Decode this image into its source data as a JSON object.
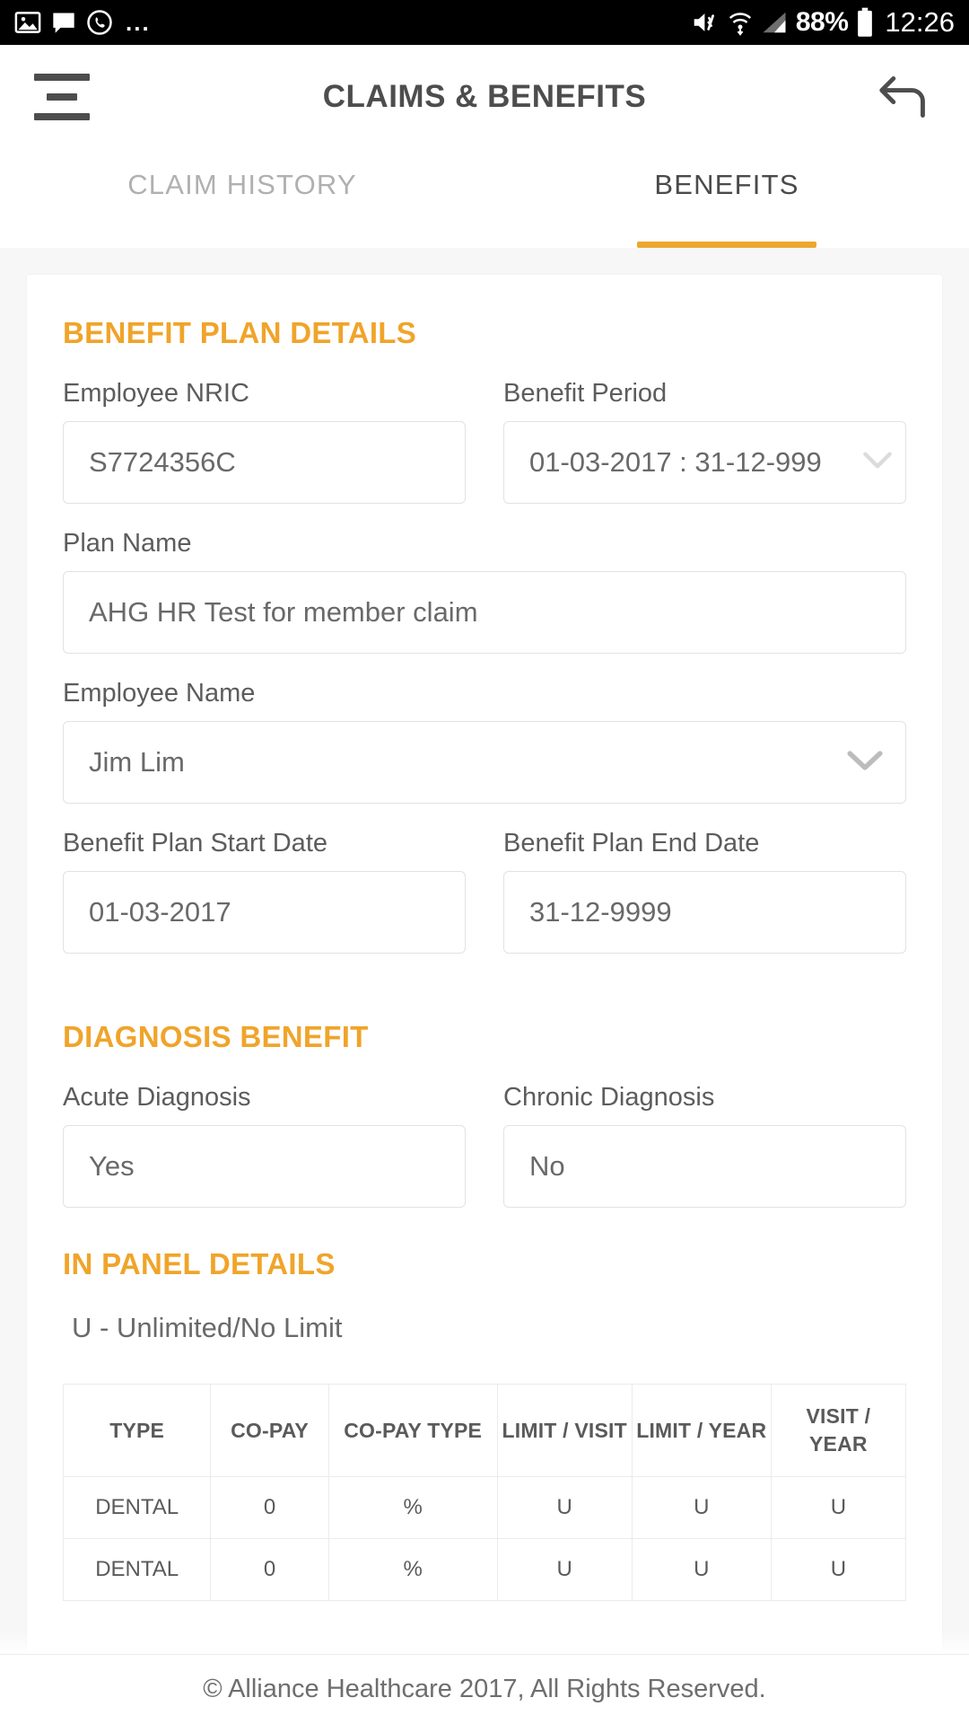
{
  "status_bar": {
    "left_icons": [
      "image-icon",
      "message-icon",
      "whatsapp-icon",
      "more-dots-icon"
    ],
    "overflow_dots": "...",
    "right_icons": [
      "mute-icon",
      "wifi-icon",
      "signal-icon",
      "battery-icon"
    ],
    "battery_percent": "88%",
    "clock": "12:26"
  },
  "header": {
    "menu_icon": "hamburger-menu-icon",
    "title": "CLAIMS & BENEFITS",
    "back_icon": "back-arrow-icon"
  },
  "tabs": [
    {
      "label": "CLAIM HISTORY",
      "active": false
    },
    {
      "label": "BENEFITS",
      "active": true
    }
  ],
  "colors": {
    "accent": "#eda72f",
    "section_title": "#f0a42a",
    "text": "#5c5c5c",
    "value_text": "#696969",
    "inactive_tab": "#b0b0b0",
    "page_bg": "#f7f7f7"
  },
  "benefit_plan_details": {
    "title": "BENEFIT PLAN DETAILS",
    "fields": [
      {
        "label": "Employee NRIC",
        "value": "S7724356C",
        "dropdown": false
      },
      {
        "label": "Benefit Period",
        "value": "01-03-2017 : 31-12-999",
        "dropdown": true
      },
      {
        "label": "Plan Name",
        "value": "AHG HR Test for member claim",
        "dropdown": false
      },
      {
        "label": "Employee Name",
        "value": "Jim Lim",
        "dropdown": true
      },
      {
        "label": "Benefit Plan Start Date",
        "value": "01-03-2017",
        "dropdown": false
      },
      {
        "label": "Benefit Plan End Date",
        "value": "31-12-9999",
        "dropdown": false
      }
    ]
  },
  "diagnosis_benefit": {
    "title": "DIAGNOSIS BENEFIT",
    "fields": [
      {
        "label": "Acute Diagnosis",
        "value": "Yes"
      },
      {
        "label": "Chronic Diagnosis",
        "value": "No"
      }
    ]
  },
  "in_panel_details": {
    "title": "IN PANEL DETAILS",
    "legend": "U - Unlimited/No Limit",
    "table": {
      "headers": [
        "TYPE",
        "CO-PAY",
        "CO-PAY TYPE",
        "LIMIT / VISIT",
        "LIMIT / YEAR",
        "VISIT / YEAR"
      ],
      "rows": [
        [
          "DENTAL",
          "0",
          "%",
          "U",
          "U",
          "U"
        ],
        [
          "DENTAL",
          "0",
          "%",
          "U",
          "U",
          "U"
        ]
      ]
    }
  },
  "footer": {
    "copyright": "© Alliance Healthcare 2017, All Rights Reserved."
  }
}
